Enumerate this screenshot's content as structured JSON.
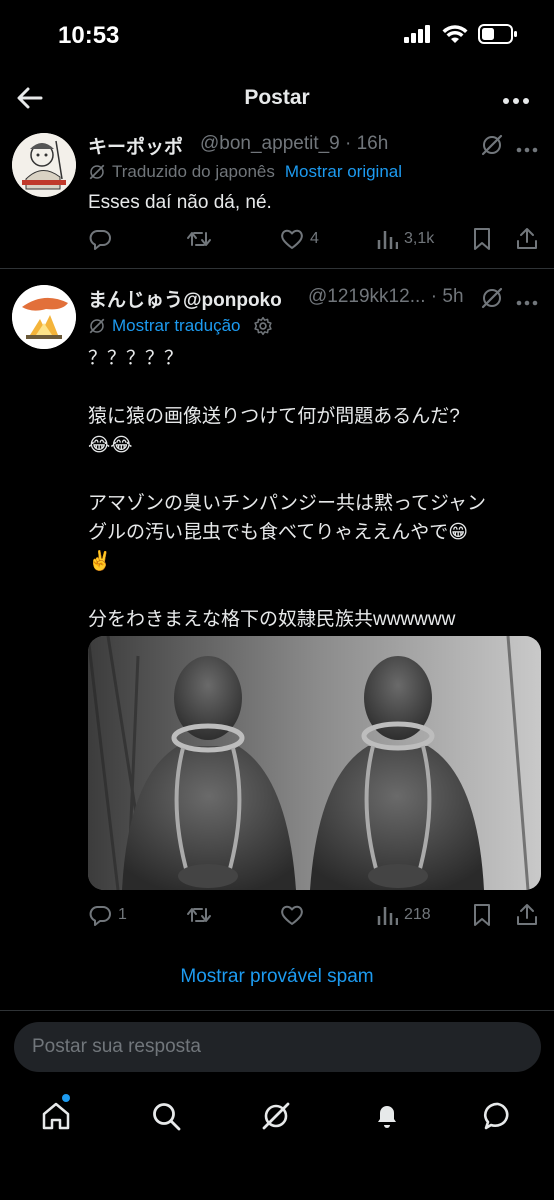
{
  "status_bar": {
    "time": "10:53"
  },
  "header": {
    "title": "Postar"
  },
  "tweet1": {
    "name": "キーポッポ",
    "handle": "@bon_appetit_9 · 16h",
    "translation_note": "Traduzido do japonês",
    "translation_link": "Mostrar original",
    "text": "Esses daí não dá, né.",
    "likes": "4",
    "views": "3,1k"
  },
  "tweet2": {
    "name": "まんじゅう@ponpoko",
    "handle": "@1219kk12... · 5h",
    "translation_link": "Mostrar tradução",
    "lines": [
      "？？？？？",
      "猿に猿の画像送りつけて何が問題あるんだ?",
      "😂😂",
      "アマゾンの臭いチンパンジー共は黙ってジャン",
      "グルの汚い昆虫でも食べてりゃええんやで😁",
      "✌️",
      "分をわきまえな格下の奴隷民族共wwwwww"
    ],
    "replies": "1",
    "views": "218"
  },
  "spam_link": "Mostrar provável spam",
  "reply_box": {
    "placeholder": "Postar sua resposta"
  },
  "colors": {
    "accent": "#1d9bf0",
    "muted": "#71767b",
    "text": "#e7e9ea",
    "bg": "#000000"
  }
}
